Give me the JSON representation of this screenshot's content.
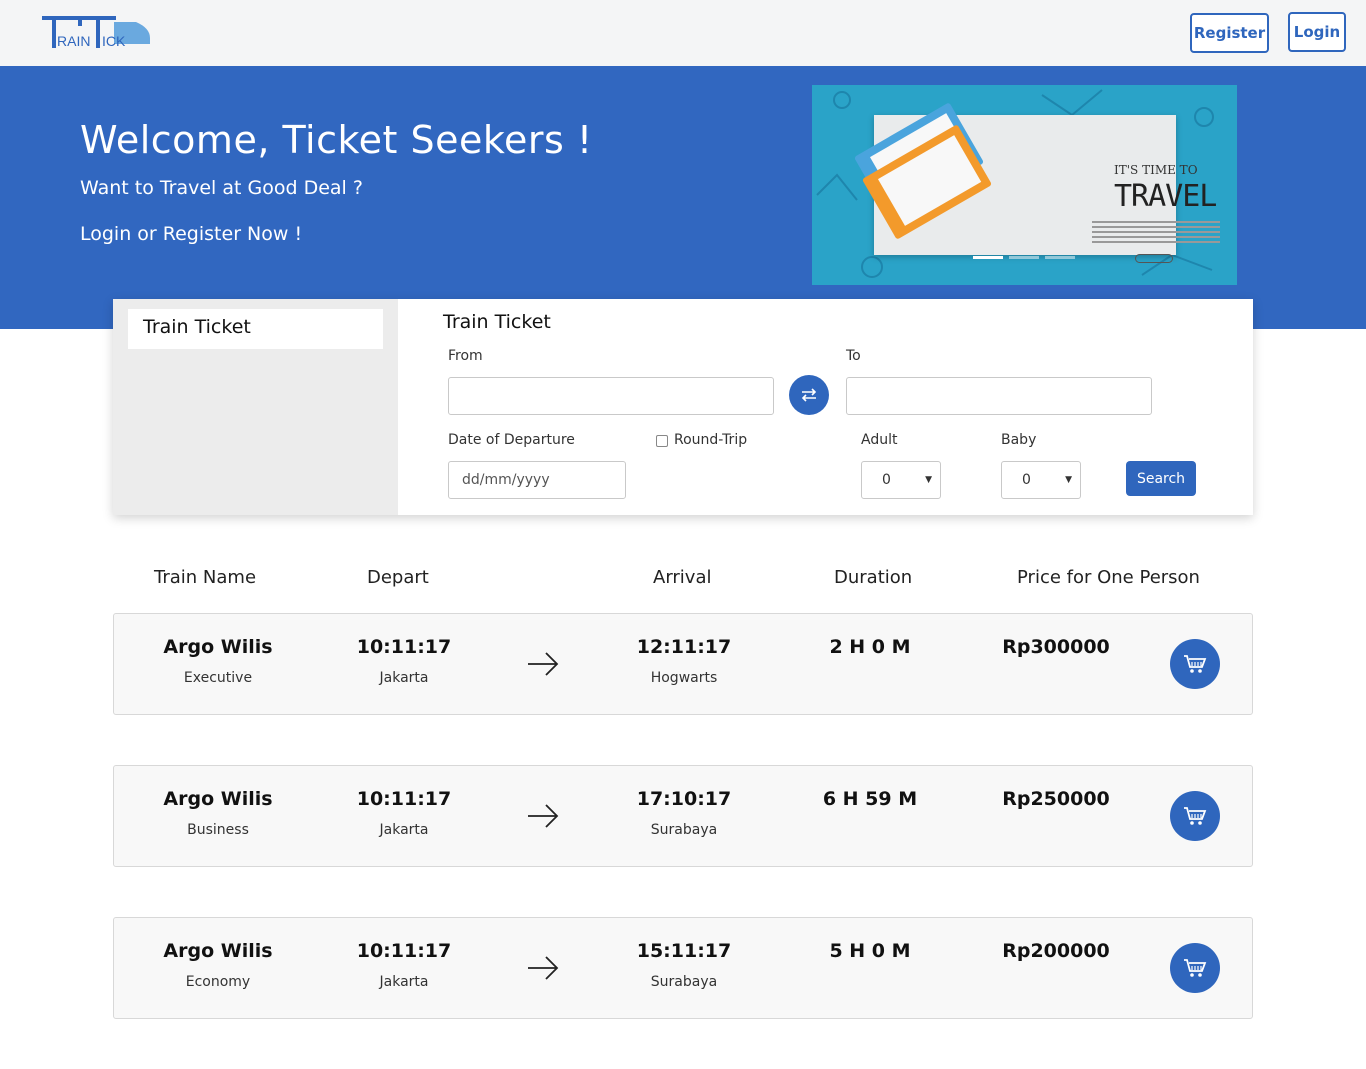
{
  "header": {
    "logo_text": "TRAINTICK",
    "register_label": "Register",
    "login_label": "Login"
  },
  "hero": {
    "title": "Welcome, Ticket Seekers !",
    "subtitle": "Want to Travel at Good Deal ?",
    "cta": "Login or Register Now !",
    "banner": {
      "its_time": "IT'S TIME TO",
      "travel": "TRAVEL"
    }
  },
  "search": {
    "tab_label": "Train Ticket",
    "title": "Train Ticket",
    "from_label": "From",
    "from_value": "",
    "to_label": "To",
    "to_value": "",
    "date_label": "Date of Departure",
    "date_placeholder": "dd/mm/yyyy",
    "round_trip_label": "Round-Trip",
    "adult_label": "Adult",
    "adult_value": "0",
    "baby_label": "Baby",
    "baby_value": "0",
    "search_label": "Search"
  },
  "table": {
    "headers": [
      "Train Name",
      "Depart",
      "Arrival",
      "Duration",
      "Price for One Person"
    ],
    "rows": [
      {
        "name": "Argo Wilis",
        "class": "Executive",
        "depart_time": "10:11:17",
        "depart_city": "Jakarta",
        "arrival_time": "12:11:17",
        "arrival_city": "Hogwarts",
        "duration": "2 H 0 M",
        "price": "Rp300000"
      },
      {
        "name": "Argo Wilis",
        "class": "Business",
        "depart_time": "10:11:17",
        "depart_city": "Jakarta",
        "arrival_time": "17:10:17",
        "arrival_city": "Surabaya",
        "duration": "6 H 59 M",
        "price": "Rp250000"
      },
      {
        "name": "Argo Wilis",
        "class": "Economy",
        "depart_time": "10:11:17",
        "depart_city": "Jakarta",
        "arrival_time": "15:11:17",
        "arrival_city": "Surabaya",
        "duration": "5 H 0 M",
        "price": "Rp200000"
      }
    ]
  },
  "colors": {
    "primary": "#3167c0",
    "button": "#2f66bd",
    "banner": "#2aa3c8"
  }
}
